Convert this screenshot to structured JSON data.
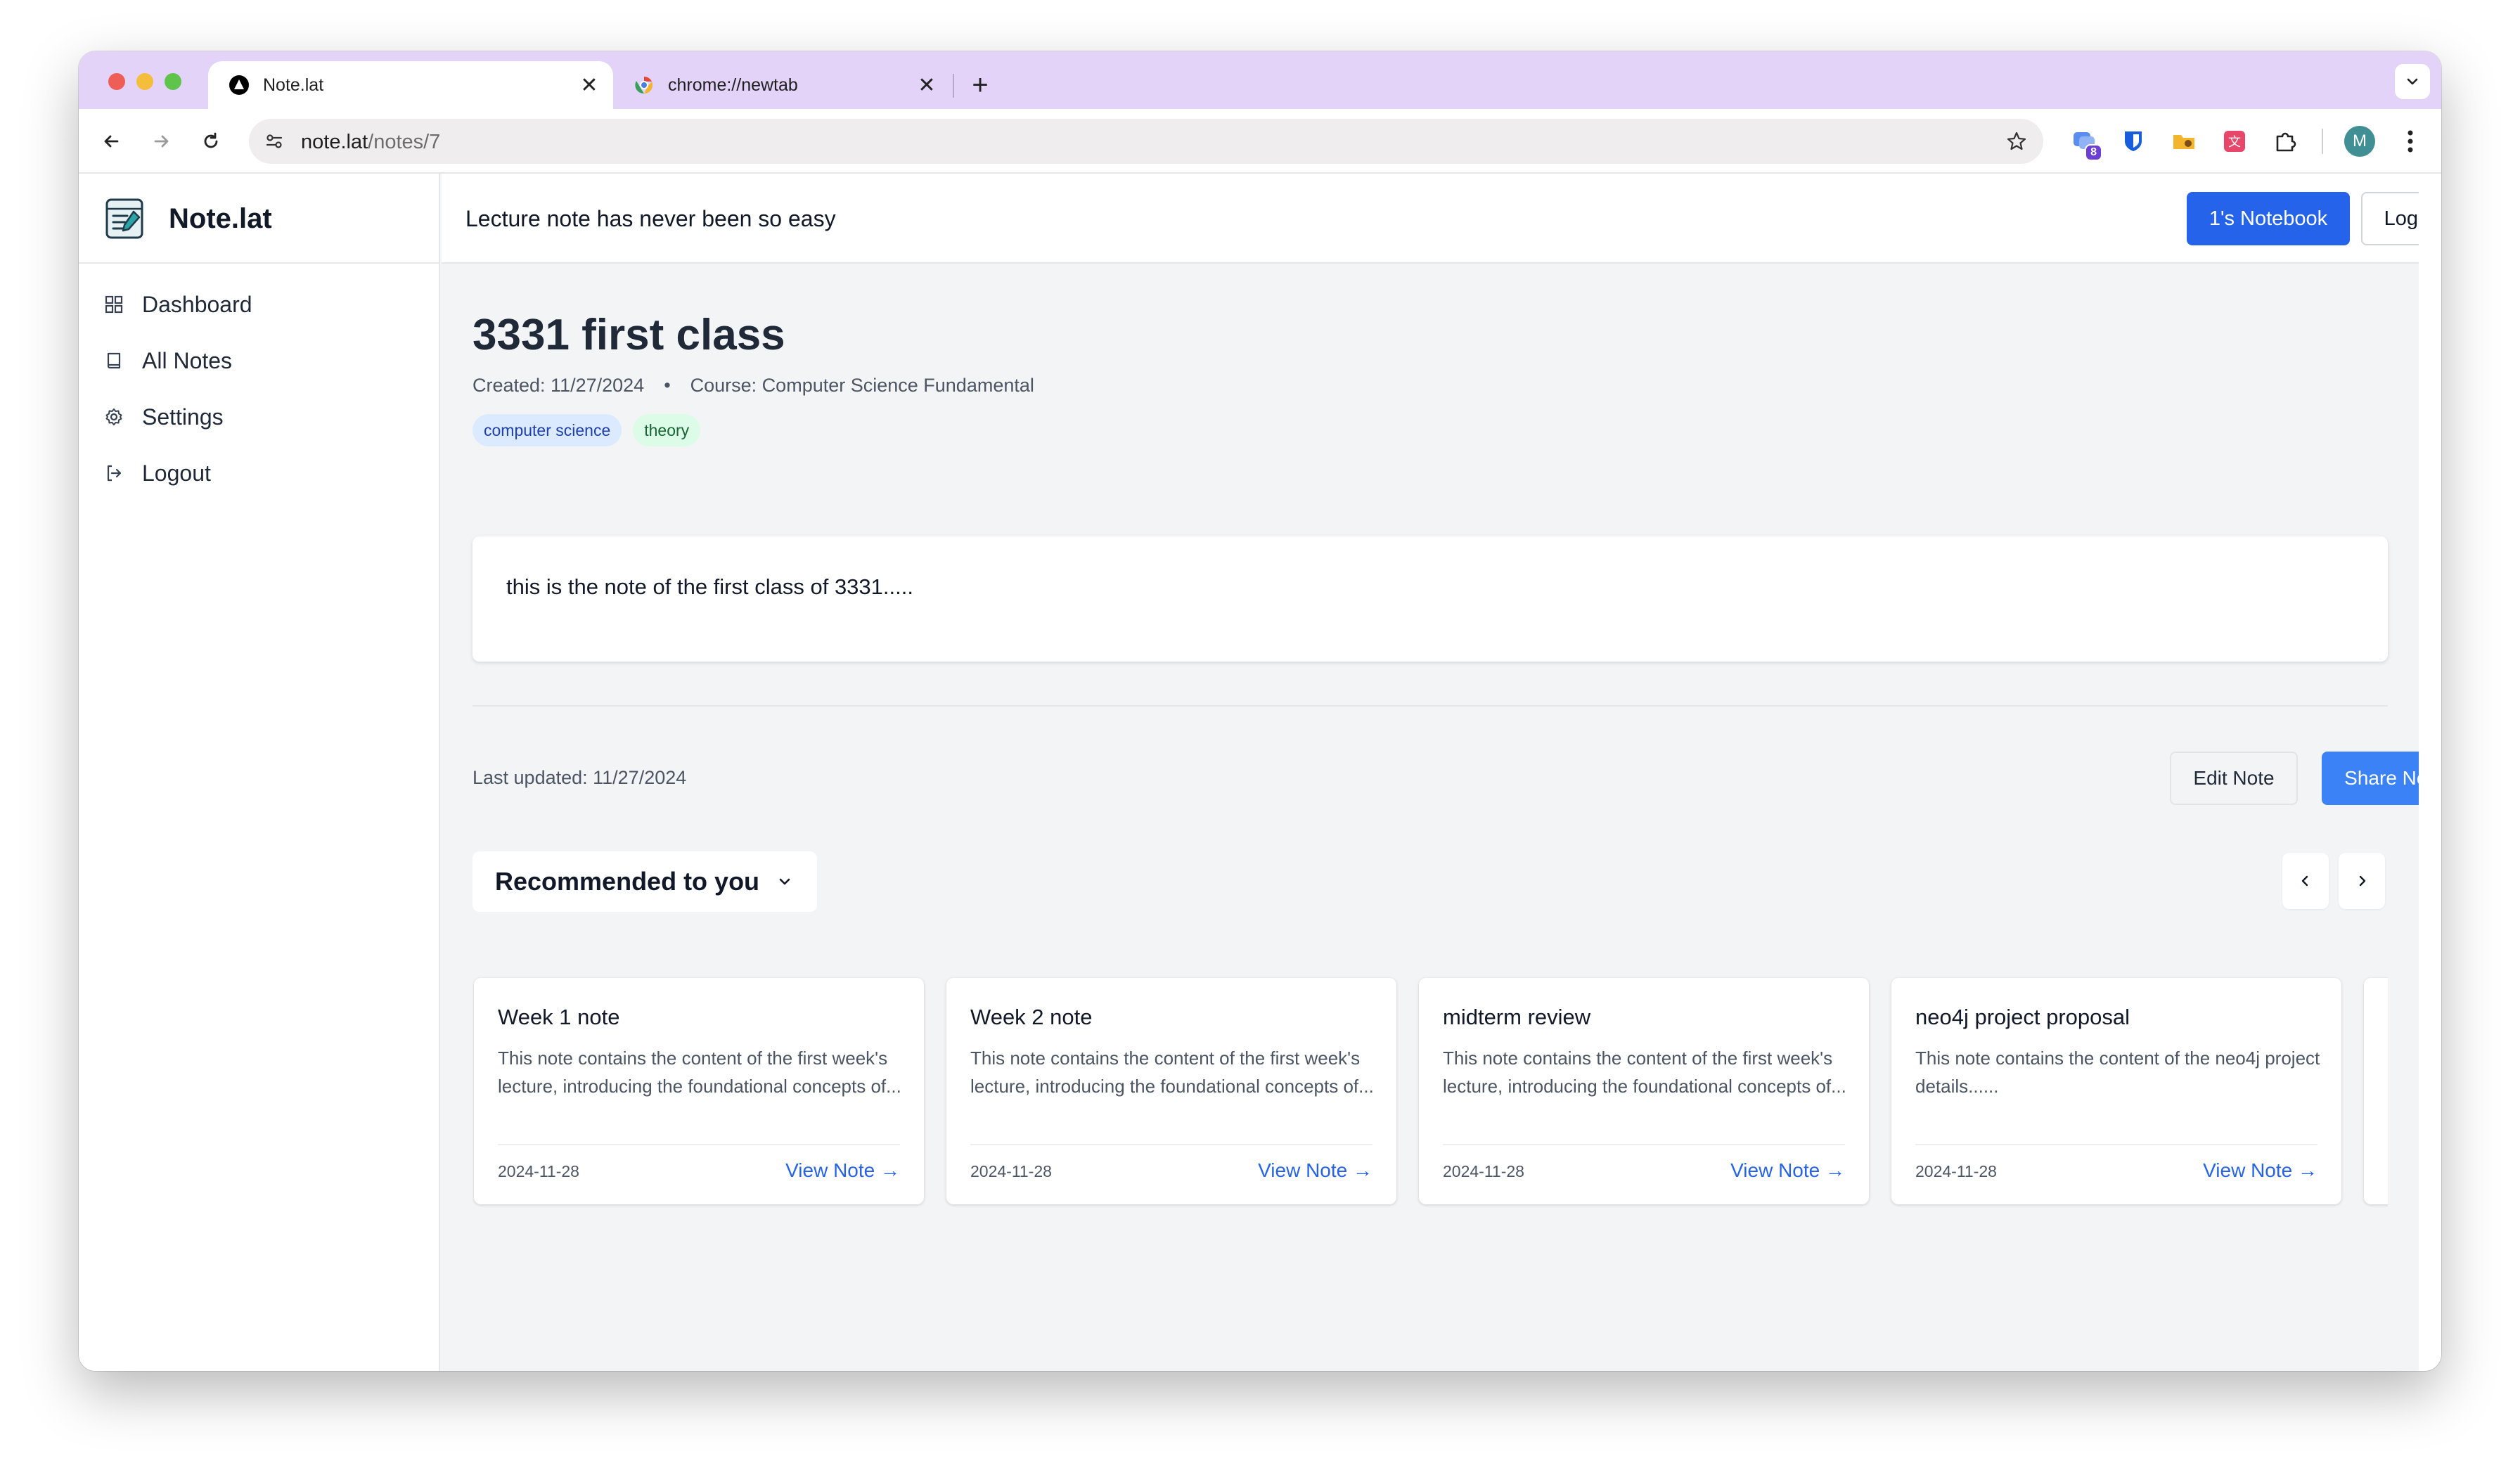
{
  "browser": {
    "tabs": [
      {
        "title": "Note.lat",
        "close": "✕"
      },
      {
        "title": "chrome://newtab",
        "close": "✕"
      }
    ],
    "new_tab": "+",
    "url_host": "note.lat",
    "url_path": "/notes/7",
    "extension_badge": "8",
    "profile_initial": "M"
  },
  "app": {
    "brand": "Note.lat",
    "tagline": "Lecture note has never been so easy",
    "header_buttons": {
      "notebook": "1's Notebook",
      "logout": "Logout"
    },
    "nav": [
      {
        "label": "Dashboard",
        "icon": "dashboard-icon"
      },
      {
        "label": "All Notes",
        "icon": "book-icon"
      },
      {
        "label": "Settings",
        "icon": "gear-icon"
      },
      {
        "label": "Logout",
        "icon": "logout-icon"
      }
    ]
  },
  "note": {
    "title": "3331 first class",
    "created": "Created: 11/27/2024",
    "separator": "•",
    "course": "Course: Computer Science Fundamental",
    "tags": [
      "computer science",
      "theory"
    ],
    "body": "this is the note of the first class of 3331.....",
    "last_updated": "Last updated: 11/27/2024",
    "edit_label": "Edit Note",
    "share_label": "Share Note"
  },
  "recommended": {
    "heading": "Recommended to you",
    "cards": [
      {
        "title": "Week 1 note",
        "desc": "This note contains the content of the first week's lecture, introducing the foundational concepts of...",
        "date": "2024-11-28",
        "link": "View Note →"
      },
      {
        "title": "Week 2 note",
        "desc": "This note contains the content of the first week's lecture, introducing the foundational concepts of...",
        "date": "2024-11-28",
        "link": "View Note →"
      },
      {
        "title": "midterm review",
        "desc": "This note contains the content of the first week's lecture, introducing the foundational concepts of...",
        "date": "2024-11-28",
        "link": "View Note →"
      },
      {
        "title": "neo4j project proposal",
        "desc": "This note contains the content of the neo4j project details......",
        "date": "2024-11-28",
        "link": "View Note →"
      }
    ]
  },
  "colors": {
    "tabstrip": "#e3d3f9",
    "primary": "#2563eb",
    "share": "#3b82f6",
    "background": "#f3f4f6"
  }
}
